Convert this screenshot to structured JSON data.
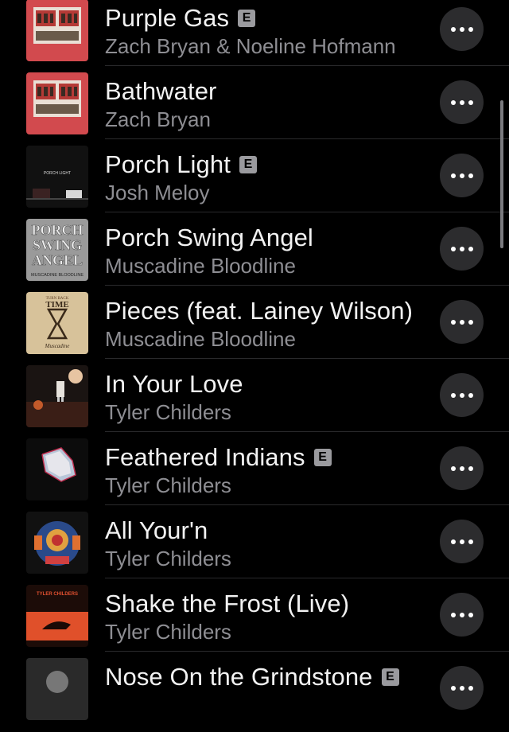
{
  "songs": [
    {
      "title": "Purple Gas",
      "explicit": true,
      "explicit_label": "E",
      "artist": "Zach Bryan & Noeline Hofmann",
      "art": "zach-bryan-album-art"
    },
    {
      "title": "Bathwater",
      "explicit": false,
      "explicit_label": "",
      "artist": "Zach Bryan",
      "art": "zach-bryan-album-art"
    },
    {
      "title": "Porch Light",
      "explicit": true,
      "explicit_label": "E",
      "artist": "Josh Meloy",
      "art": "porch-light-album-art",
      "art_text": "PORCH LIGHT"
    },
    {
      "title": "Porch Swing Angel",
      "explicit": false,
      "explicit_label": "",
      "artist": "Muscadine Bloodline",
      "art": "porch-swing-angel-album-art",
      "art_text": [
        "PORCH",
        "SWING",
        "ANGEL",
        "MUSCADINE BLOODLINE"
      ]
    },
    {
      "title": "Pieces (feat. Lainey Wilson)",
      "explicit": false,
      "explicit_label": "",
      "artist": "Muscadine Bloodline",
      "art": "hourglass-album-art",
      "art_text": [
        "TURN BACK",
        "TIME",
        "Muscadine"
      ]
    },
    {
      "title": "In Your Love",
      "explicit": false,
      "explicit_label": "",
      "artist": "Tyler Childers",
      "art": "in-your-love-album-art"
    },
    {
      "title": "Feathered Indians",
      "explicit": true,
      "explicit_label": "E",
      "artist": "Tyler Childers",
      "art": "feathered-indians-album-art"
    },
    {
      "title": "All Your'n",
      "explicit": false,
      "explicit_label": "",
      "artist": "Tyler Childers",
      "art": "all-yourn-album-art"
    },
    {
      "title": "Shake the Frost (Live)",
      "explicit": false,
      "explicit_label": "",
      "artist": "Tyler Childers",
      "art": "shake-the-frost-album-art",
      "art_text": "TYLER CHILDERS"
    },
    {
      "title": "Nose On the Grindstone",
      "explicit": true,
      "explicit_label": "E",
      "artist": "",
      "art": "nose-on-the-grindstone-album-art"
    }
  ],
  "more_icon": "ellipsis-icon",
  "colors": {
    "background": "#000000",
    "title": "#f2f2f2",
    "artist": "#8e8e93",
    "more_button": "#2c2c2e",
    "explicit_badge": "#9a9a9e"
  }
}
